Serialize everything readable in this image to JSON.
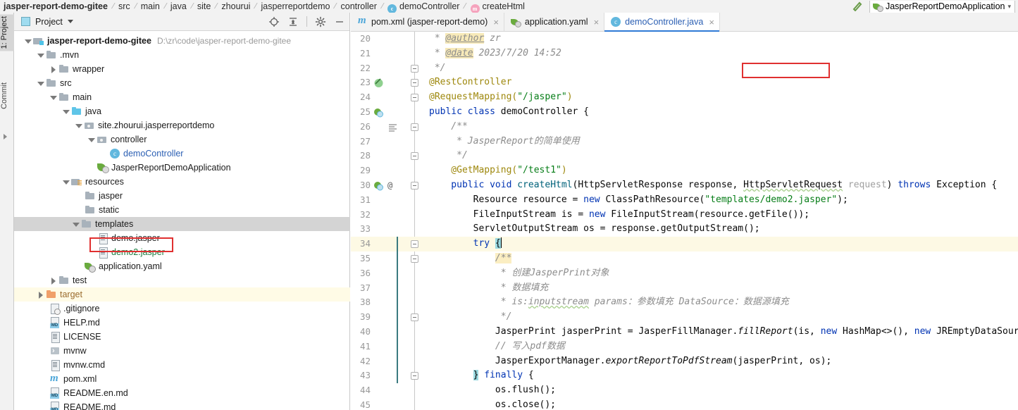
{
  "breadcrumb": {
    "items": [
      {
        "label": "jasper-report-demo-gitee",
        "bold": true,
        "icon": ""
      },
      {
        "label": "src",
        "bold": false,
        "icon": ""
      },
      {
        "label": "main",
        "bold": false,
        "icon": ""
      },
      {
        "label": "java",
        "bold": false,
        "icon": ""
      },
      {
        "label": "site",
        "bold": false,
        "icon": ""
      },
      {
        "label": "zhourui",
        "bold": false,
        "icon": ""
      },
      {
        "label": "jasperreportdemo",
        "bold": false,
        "icon": ""
      },
      {
        "label": "controller",
        "bold": false,
        "icon": ""
      },
      {
        "label": "demoController",
        "bold": false,
        "icon": "class-icon"
      },
      {
        "label": "createHtml",
        "bold": false,
        "icon": "method-icon"
      }
    ],
    "separator": "/",
    "class_icon_letter": "c",
    "method_icon_letter": "m"
  },
  "toolbar_right": {
    "build_icon": "hammer-icon",
    "run_config_name": "JasperReportDemoApplication",
    "run_config_icon": "spring-boot-icon",
    "chevron": "▾"
  },
  "tool_strip": {
    "top_label": "1: Project",
    "bottom_label": "Commit"
  },
  "project_pane": {
    "title": "Project",
    "title_icon": "project-view-icon",
    "dropdown_icon": "chevron-down-icon",
    "tools": [
      "locate-icon",
      "collapse-all-icon",
      "settings-icon",
      "hide-icon"
    ],
    "tree": [
      {
        "depth": 0,
        "arrow": "open",
        "icon": "module-folder-icon",
        "label": "jasper-report-demo-gitee",
        "bold": true,
        "path": "D:\\zr\\code\\jasper-report-demo-gitee"
      },
      {
        "depth": 1,
        "arrow": "open",
        "icon": "folder-icon",
        "label": ".mvn"
      },
      {
        "depth": 2,
        "arrow": "closed",
        "icon": "folder-icon",
        "label": "wrapper"
      },
      {
        "depth": 1,
        "arrow": "open",
        "icon": "folder-icon",
        "label": "src"
      },
      {
        "depth": 2,
        "arrow": "open",
        "icon": "folder-icon",
        "label": "main"
      },
      {
        "depth": 3,
        "arrow": "open",
        "icon": "source-folder-icon",
        "label": "java"
      },
      {
        "depth": 4,
        "arrow": "open",
        "icon": "package-icon",
        "label": "site.zhourui.jasperreportdemo"
      },
      {
        "depth": 5,
        "arrow": "open",
        "icon": "package-icon",
        "label": "controller"
      },
      {
        "depth": 6,
        "arrow": "none",
        "icon": "java-class-icon",
        "label": "demoController",
        "color": "blue"
      },
      {
        "depth": 5,
        "arrow": "none",
        "icon": "spring-app-icon",
        "label": "JasperReportDemoApplication"
      },
      {
        "depth": 3,
        "arrow": "open",
        "icon": "resources-folder-icon",
        "label": "resources"
      },
      {
        "depth": 4,
        "arrow": "none",
        "icon": "folder-icon",
        "label": "jasper"
      },
      {
        "depth": 4,
        "arrow": "none",
        "icon": "folder-icon",
        "label": "static"
      },
      {
        "depth": 4,
        "arrow": "open",
        "icon": "folder-icon",
        "label": "templates",
        "selected": true
      },
      {
        "depth": 5,
        "arrow": "none",
        "icon": "file-icon",
        "label": "demo.jasper"
      },
      {
        "depth": 5,
        "arrow": "none",
        "icon": "file-icon",
        "label": "demo2.jasper",
        "color": "green",
        "highlight_box": true
      },
      {
        "depth": 4,
        "arrow": "none",
        "icon": "spring-yaml-icon",
        "label": "application.yaml"
      },
      {
        "depth": 2,
        "arrow": "closed",
        "icon": "folder-icon",
        "label": "test"
      },
      {
        "depth": 1,
        "arrow": "closed",
        "icon": "target-folder-icon",
        "label": "target",
        "color": "orange",
        "row_highlight": true
      },
      {
        "depth": 2,
        "arrow": "none",
        "icon": "gitignore-icon",
        "label": ".gitignore"
      },
      {
        "depth": 2,
        "arrow": "none",
        "icon": "markdown-icon",
        "label": "HELP.md"
      },
      {
        "depth": 2,
        "arrow": "none",
        "icon": "file-icon",
        "label": "LICENSE"
      },
      {
        "depth": 2,
        "arrow": "none",
        "icon": "shell-script-icon",
        "label": "mvnw"
      },
      {
        "depth": 2,
        "arrow": "none",
        "icon": "file-icon",
        "label": "mvnw.cmd"
      },
      {
        "depth": 2,
        "arrow": "none",
        "icon": "maven-icon",
        "label": "pom.xml"
      },
      {
        "depth": 2,
        "arrow": "none",
        "icon": "markdown-icon",
        "label": "README.en.md"
      },
      {
        "depth": 2,
        "arrow": "none",
        "icon": "markdown-icon",
        "label": "README.md"
      }
    ]
  },
  "editor": {
    "tabs": [
      {
        "label": "pom.xml (jasper-report-demo)",
        "icon": "maven-icon",
        "active": false,
        "close": "×"
      },
      {
        "label": "application.yaml",
        "icon": "spring-yaml-icon",
        "active": false,
        "close": "×"
      },
      {
        "label": "demoController.java",
        "icon": "java-class-icon",
        "active": true,
        "close": "×"
      }
    ],
    "first_line_number": 20,
    "lines": [
      {
        "n": 20,
        "text": " * @author zr"
      },
      {
        "n": 21,
        "text": " * @date 2023/7/20 14:52"
      },
      {
        "n": 22,
        "text": " */"
      },
      {
        "n": 23,
        "text": "@RestController"
      },
      {
        "n": 24,
        "text": "@RequestMapping(\"/jasper\")"
      },
      {
        "n": 25,
        "text": "public class demoController {"
      },
      {
        "n": 26,
        "text": "    /**"
      },
      {
        "n": 27,
        "text": "     * JasperReport的简单使用"
      },
      {
        "n": 28,
        "text": "     */"
      },
      {
        "n": 29,
        "text": "    @GetMapping(\"/test1\")"
      },
      {
        "n": 30,
        "text": "    public void createHtml(HttpServletResponse response, HttpServletRequest request) throws Exception {"
      },
      {
        "n": 31,
        "text": "        Resource resource = new ClassPathResource(\"templates/demo2.jasper\");"
      },
      {
        "n": 32,
        "text": "        FileInputStream is = new FileInputStream(resource.getFile());"
      },
      {
        "n": 33,
        "text": "        ServletOutputStream os = response.getOutputStream();"
      },
      {
        "n": 34,
        "text": "        try {",
        "highlight": true
      },
      {
        "n": 35,
        "text": "            /**"
      },
      {
        "n": 36,
        "text": "             * 创建JasperPrint对象"
      },
      {
        "n": 37,
        "text": "             * 数据填充"
      },
      {
        "n": 38,
        "text": "             * is:inputstream params：参数填充 DataSource：数据源填充"
      },
      {
        "n": 39,
        "text": "             */"
      },
      {
        "n": 40,
        "text": "            JasperPrint jasperPrint = JasperFillManager.fillReport(is, new HashMap<>(), new JREmptyDataSource"
      },
      {
        "n": 41,
        "text": "            // 写入pdf数据"
      },
      {
        "n": 42,
        "text": "            JasperExportManager.exportReportToPdfStream(jasperPrint, os);"
      },
      {
        "n": 43,
        "text": "        } finally {"
      },
      {
        "n": 44,
        "text": "            os.flush();"
      },
      {
        "n": 45,
        "text": "            os.close();"
      }
    ],
    "annotation_box_label": "demo2.jasper highlight"
  },
  "colors": {
    "accent": "#2f7ad6",
    "annotation_red": "#e03030",
    "string_green": "#067d17",
    "keyword_blue": "#0033b3",
    "comment_gray": "#8c8c8c",
    "annotation_yellow": "#9e880d",
    "selection_gray": "#d4d4d4",
    "line_highlight": "#fdf9e4"
  }
}
